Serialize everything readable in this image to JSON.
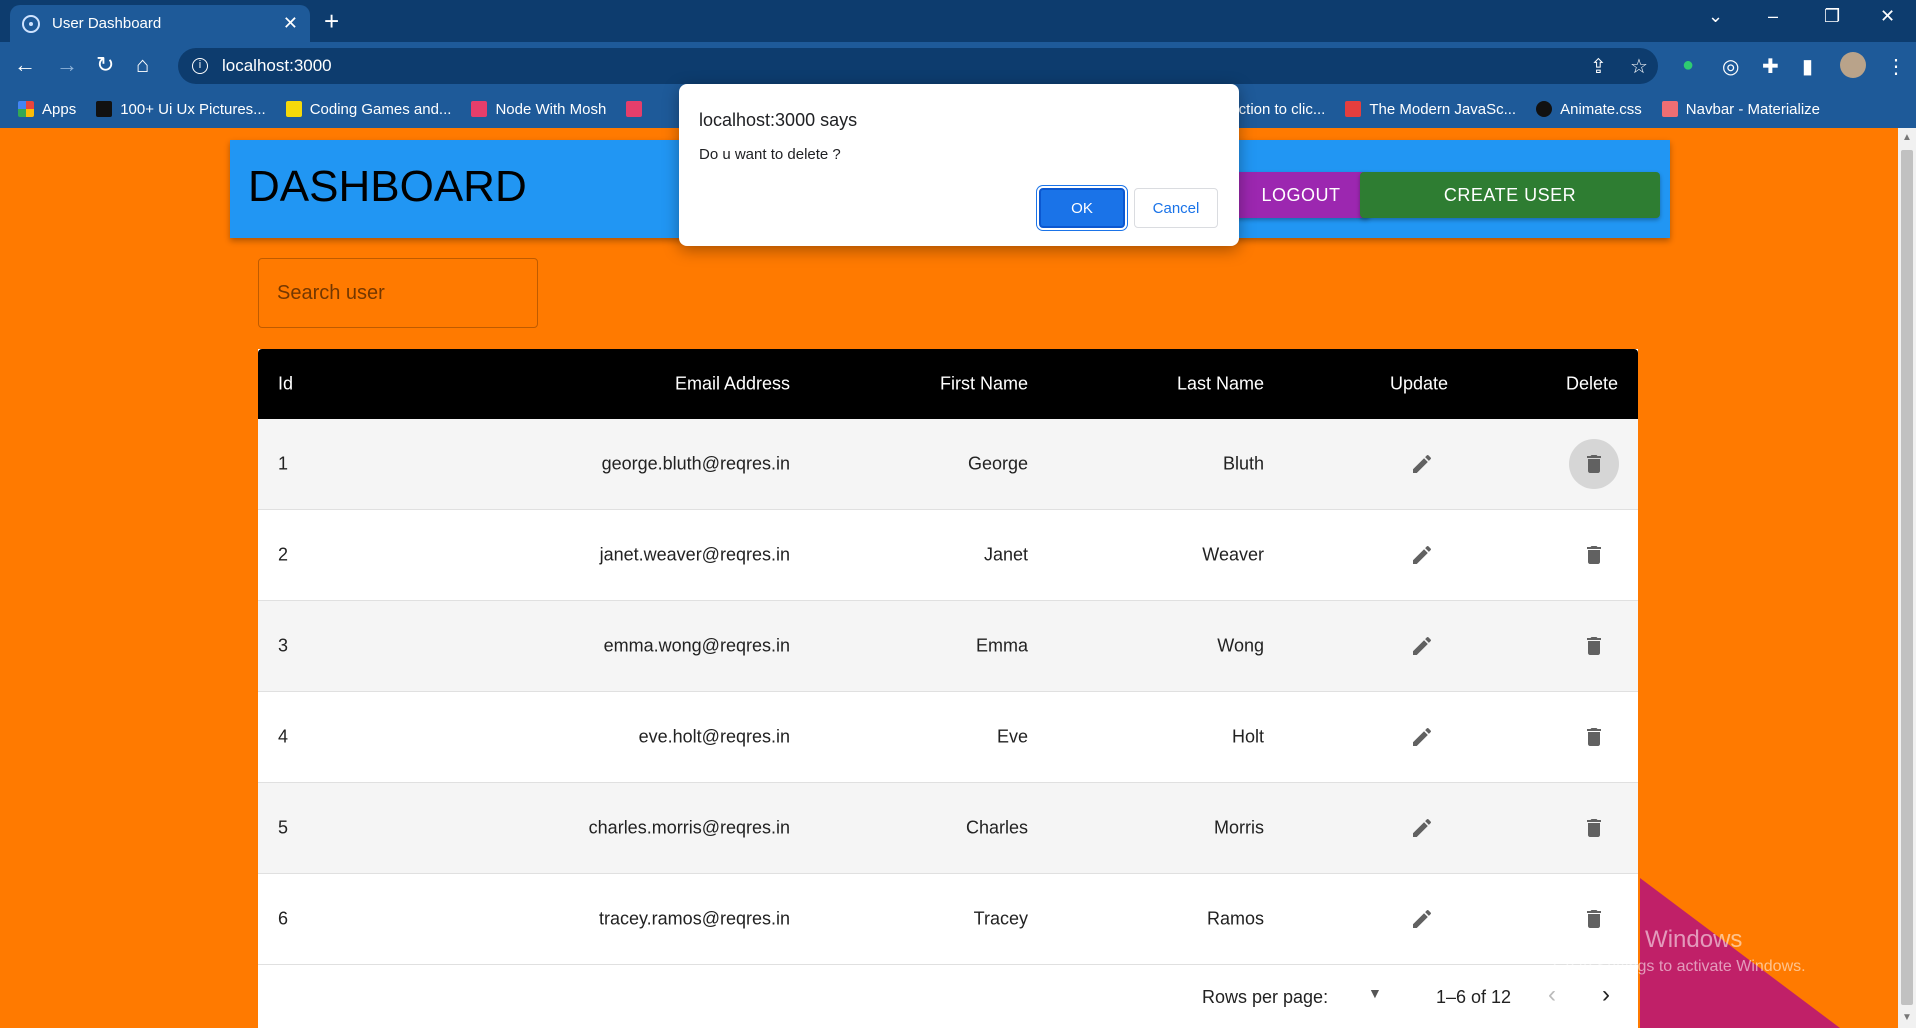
{
  "browser": {
    "tab_title": "User Dashboard",
    "url": "localhost:3000",
    "bookmarks": [
      {
        "label": "Apps",
        "color": "#e8453c"
      },
      {
        "label": "100+ Ui Ux Pictures...",
        "color": "#111111"
      },
      {
        "label": "Coding Games and...",
        "color": "#f5d90a"
      },
      {
        "label": "Node With Mosh",
        "color": "#e53e6b"
      },
      {
        "label": "",
        "color": "#e53e6b"
      },
      {
        "label": "uction to clic...",
        "color": "#ffffff"
      },
      {
        "label": "The Modern JavaSc...",
        "color": "#e53e3e"
      },
      {
        "label": "Animate.css",
        "color": "#111111"
      },
      {
        "label": "Navbar - Materialize",
        "color": "#ee6e73"
      }
    ]
  },
  "header": {
    "title": "DASHBOARD",
    "logout_label": "LOGOUT",
    "create_label": "CREATE USER"
  },
  "search": {
    "placeholder": "Search user"
  },
  "table": {
    "columns": [
      "Id",
      "Email Address",
      "First Name",
      "Last Name",
      "Update",
      "Delete"
    ],
    "rows": [
      {
        "id": "1",
        "email": "george.bluth@reqres.in",
        "first": "George",
        "last": "Bluth"
      },
      {
        "id": "2",
        "email": "janet.weaver@reqres.in",
        "first": "Janet",
        "last": "Weaver"
      },
      {
        "id": "3",
        "email": "emma.wong@reqres.in",
        "first": "Emma",
        "last": "Wong"
      },
      {
        "id": "4",
        "email": "eve.holt@reqres.in",
        "first": "Eve",
        "last": "Holt"
      },
      {
        "id": "5",
        "email": "charles.morris@reqres.in",
        "first": "Charles",
        "last": "Morris"
      },
      {
        "id": "6",
        "email": "tracey.ramos@reqres.in",
        "first": "Tracey",
        "last": "Ramos"
      }
    ],
    "pagination": {
      "rows_per_page_label": "Rows per page:",
      "range": "1–6 of 12"
    }
  },
  "dialog": {
    "title": "localhost:3000 says",
    "message": "Do u want to delete ?",
    "ok_label": "OK",
    "cancel_label": "Cancel"
  },
  "watermark": {
    "line1": "Activate Windows",
    "line2": "Go to Settings to activate Windows."
  },
  "colors": {
    "page_bg": "#ff7a00",
    "header_bg": "#2196f3",
    "logout_bg": "#9c27b0",
    "create_bg": "#2e7d32",
    "table_head_bg": "#000000"
  }
}
